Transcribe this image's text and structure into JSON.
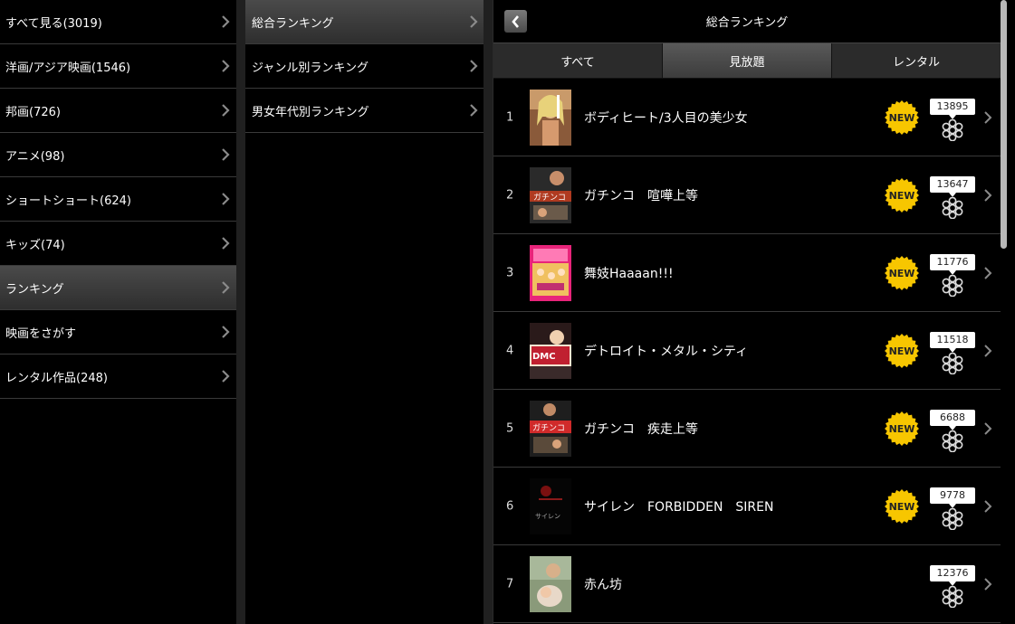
{
  "sidebar": {
    "items": [
      {
        "label": "すべて見る(3019)",
        "active": false
      },
      {
        "label": "洋画/アジア映画(1546)",
        "active": false
      },
      {
        "label": "邦画(726)",
        "active": false
      },
      {
        "label": "アニメ(98)",
        "active": false
      },
      {
        "label": "ショートショート(624)",
        "active": false
      },
      {
        "label": "キッズ(74)",
        "active": false
      },
      {
        "label": "ランキング",
        "active": true
      },
      {
        "label": "映画をさがす",
        "active": false
      },
      {
        "label": "レンタル作品(248)",
        "active": false
      }
    ]
  },
  "submenu": {
    "items": [
      {
        "label": "総合ランキング",
        "active": true
      },
      {
        "label": "ジャンル別ランキング",
        "active": false
      },
      {
        "label": "男女年代別ランキング",
        "active": false
      }
    ]
  },
  "main": {
    "header_title": "総合ランキング",
    "tabs": [
      {
        "label": "すべて",
        "active": false
      },
      {
        "label": "見放題",
        "active": true
      },
      {
        "label": "レンタル",
        "active": false
      }
    ],
    "new_badge_label": "NEW",
    "rankings": [
      {
        "rank": "1",
        "title": "ボディヒート/3人目の美少女",
        "count": "13895",
        "is_new": true,
        "thumb": "poster-woman"
      },
      {
        "rank": "2",
        "title": "ガチンコ　喧嘩上等",
        "count": "13647",
        "is_new": true,
        "thumb": "poster-action"
      },
      {
        "rank": "3",
        "title": "舞妓Haaaan!!!",
        "count": "11776",
        "is_new": true,
        "thumb": "poster-pink"
      },
      {
        "rank": "4",
        "title": "デトロイト・メタル・シティ",
        "count": "11518",
        "is_new": true,
        "thumb": "poster-metal"
      },
      {
        "rank": "5",
        "title": "ガチンコ　疾走上等",
        "count": "6688",
        "is_new": true,
        "thumb": "poster-action2"
      },
      {
        "rank": "6",
        "title": "サイレン　FORBIDDEN　SIREN",
        "count": "9778",
        "is_new": true,
        "thumb": "poster-dark"
      },
      {
        "rank": "7",
        "title": "赤ん坊",
        "count": "12376",
        "is_new": false,
        "thumb": "poster-baby"
      }
    ]
  },
  "colors": {
    "badge_yellow": "#f7c600",
    "active_gradient_top": "#595959",
    "divider": "#3a3a3a"
  }
}
